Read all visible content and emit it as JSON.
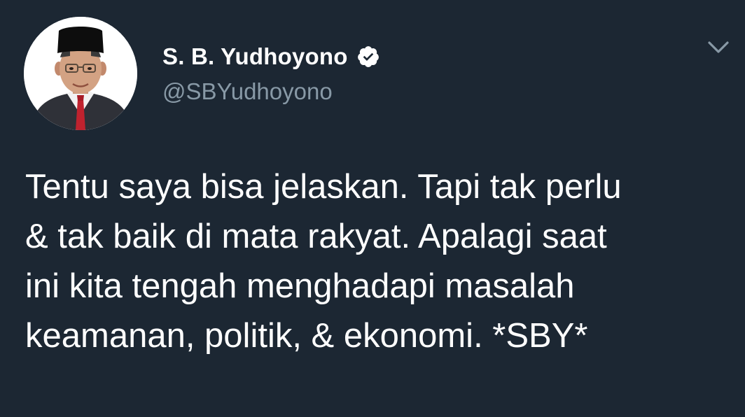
{
  "tweet": {
    "author": {
      "display_name": "S. B. Yudhoyono",
      "handle": "@SBYudhoyono",
      "verified_icon": "verified-badge-icon",
      "avatar": "profile-photo"
    },
    "menu_icon": "chevron-down-icon",
    "text_lines": [
      "Tentu saya bisa jelaskan. Tapi tak perlu",
      "& tak baik di mata rakyat. Apalagi saat",
      "ini kita tengah menghadapi masalah",
      "keamanan, politik, & ekonomi. *SBY*"
    ]
  },
  "colors": {
    "background": "#1c2733",
    "primary_text": "#ffffff",
    "secondary_text": "#8899a6",
    "chevron": "#8899a6"
  }
}
